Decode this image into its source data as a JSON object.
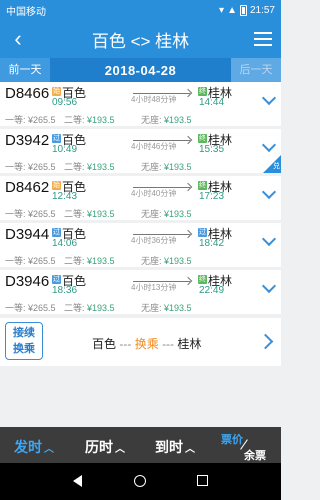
{
  "status_bar": {
    "carrier": "中国移动",
    "time": "21:57",
    "battery_icon": "battery-icon"
  },
  "header": {
    "title": "百色 <> 桂林",
    "back_icon": "back-chevron-icon",
    "menu_icon": "menu-icon"
  },
  "date_bar": {
    "prev_label": "前一天",
    "date": "2018-04-28",
    "next_label": "后一天"
  },
  "trains": [
    {
      "number": "D8466",
      "from_badge": "始",
      "from": "百色",
      "depart": "09:56",
      "duration": "4小时48分钟",
      "to_badge": "终",
      "to": "桂林",
      "arrive": "14:44",
      "first_class": "一等: ¥265.5",
      "second_label": "二等: ",
      "second_price": "¥193.5",
      "noseat_label": "无座: ",
      "noseat_price": "¥193.5"
    },
    {
      "number": "D3942",
      "from_badge": "过",
      "from": "百色",
      "depart": "10:49",
      "duration": "4小时46分钟",
      "to_badge": "终",
      "to": "桂林",
      "arrive": "15:35",
      "first_class": "一等: ¥265.5",
      "second_label": "二等: ",
      "second_price": "¥193.5",
      "noseat_label": "无座: ",
      "noseat_price": "¥193.5",
      "corner": "兑"
    },
    {
      "number": "D8462",
      "from_badge": "始",
      "from": "百色",
      "depart": "12:43",
      "duration": "4小时40分钟",
      "to_badge": "终",
      "to": "桂林",
      "arrive": "17:23",
      "first_class": "一等: ¥265.5",
      "second_label": "二等: ",
      "second_price": "¥193.5",
      "noseat_label": "无座: ",
      "noseat_price": "¥193.5"
    },
    {
      "number": "D3944",
      "from_badge": "过",
      "from": "百色",
      "depart": "14:06",
      "duration": "4小时36分钟",
      "to_badge": "过",
      "to": "桂林",
      "arrive": "18:42",
      "first_class": "一等: ¥265.5",
      "second_label": "二等: ",
      "second_price": "¥193.5",
      "noseat_label": "无座: ",
      "noseat_price": "¥193.5"
    },
    {
      "number": "D3946",
      "from_badge": "过",
      "from": "百色",
      "depart": "18:36",
      "duration": "4小时13分钟",
      "to_badge": "终",
      "to": "桂林",
      "arrive": "22:49",
      "first_class": "一等: ¥265.5",
      "second_label": "二等: ",
      "second_price": "¥193.5",
      "noseat_label": "无座: ",
      "noseat_price": "¥193.5"
    }
  ],
  "transfer": {
    "button_line1": "接续",
    "button_line2": "换乘",
    "from": "百色",
    "middle": "换乘",
    "to": "桂林",
    "dash": "---"
  },
  "bottom_tabs": {
    "depart_time": "发时",
    "travel_time": "历时",
    "arrive_time": "到时",
    "price": "票价",
    "remaining": "余票",
    "sort_icon": "caret-up-icon"
  },
  "colors": {
    "primary": "#2a8fdb",
    "price_green": "#3aa37a",
    "time_green": "#2e9b86",
    "highlight_orange": "#f08c22",
    "bottom_bar": "#3c3c3c"
  }
}
